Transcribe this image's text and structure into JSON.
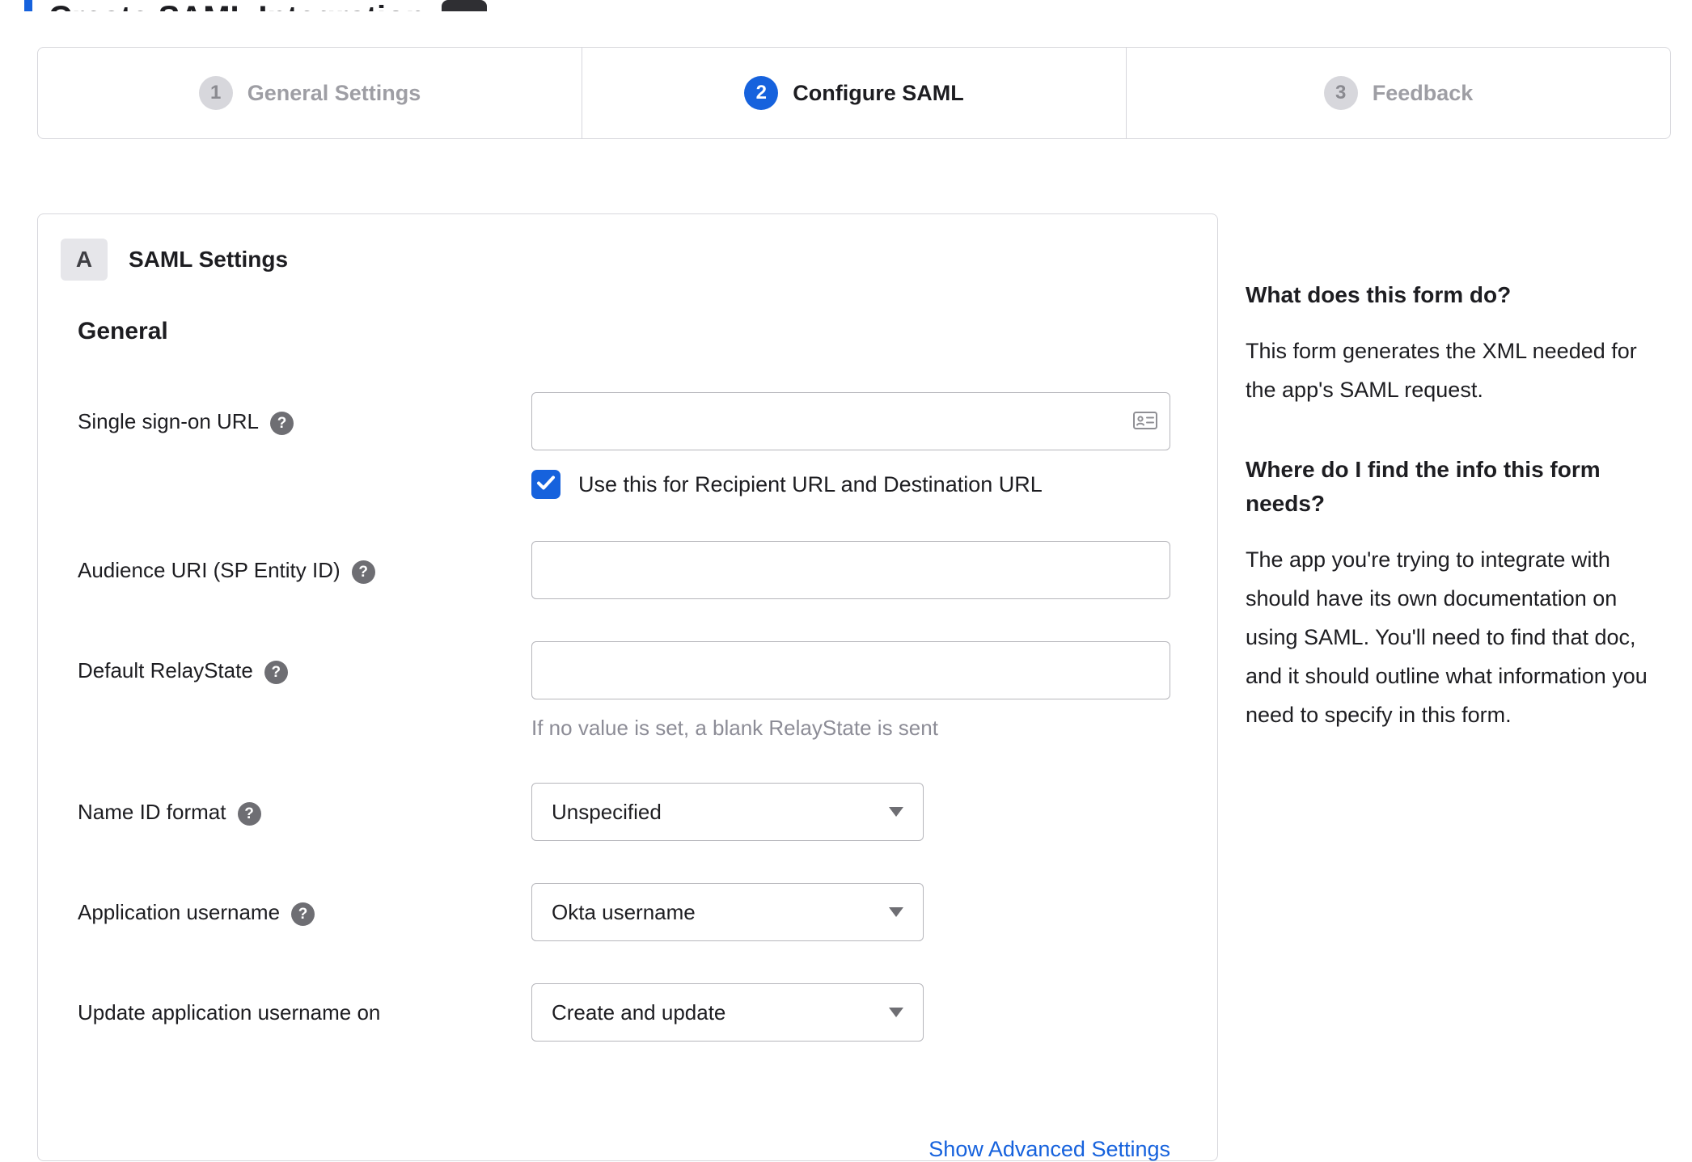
{
  "page": {
    "clipped_title": "Create SAML Integration"
  },
  "icons": {
    "help": "?"
  },
  "colors": {
    "accent": "#1662dd",
    "border_gray": "#d7d7dc",
    "text_gray": "#8c8c96"
  },
  "stepper": {
    "steps": [
      {
        "number": "1",
        "label": "General Settings",
        "state": "inactive"
      },
      {
        "number": "2",
        "label": "Configure SAML",
        "state": "active"
      },
      {
        "number": "3",
        "label": "Feedback",
        "state": "inactive"
      }
    ]
  },
  "panel": {
    "badge": "A",
    "title": "SAML Settings",
    "section_heading": "General",
    "fields": {
      "sso_url": {
        "label": "Single sign-on URL",
        "value": "",
        "checkbox_label": "Use this for Recipient URL and Destination URL",
        "checkbox_checked": true
      },
      "audience_uri": {
        "label": "Audience URI (SP Entity ID)",
        "value": ""
      },
      "relay_state": {
        "label": "Default RelayState",
        "value": "",
        "hint": "If no value is set, a blank RelayState is sent"
      },
      "name_id_format": {
        "label": "Name ID format",
        "value": "Unspecified"
      },
      "app_username": {
        "label": "Application username",
        "value": "Okta username"
      },
      "update_username": {
        "label": "Update application username on",
        "value": "Create and update"
      }
    },
    "advanced_link": "Show Advanced Settings"
  },
  "sidebar": {
    "sections": [
      {
        "heading": "What does this form do?",
        "body": "This form generates the XML needed for the app's SAML request."
      },
      {
        "heading": "Where do I find the info this form needs?",
        "body": "The app you're trying to integrate with should have its own documentation on using SAML. You'll need to find that doc, and it should outline what information you need to specify in this form."
      }
    ]
  }
}
